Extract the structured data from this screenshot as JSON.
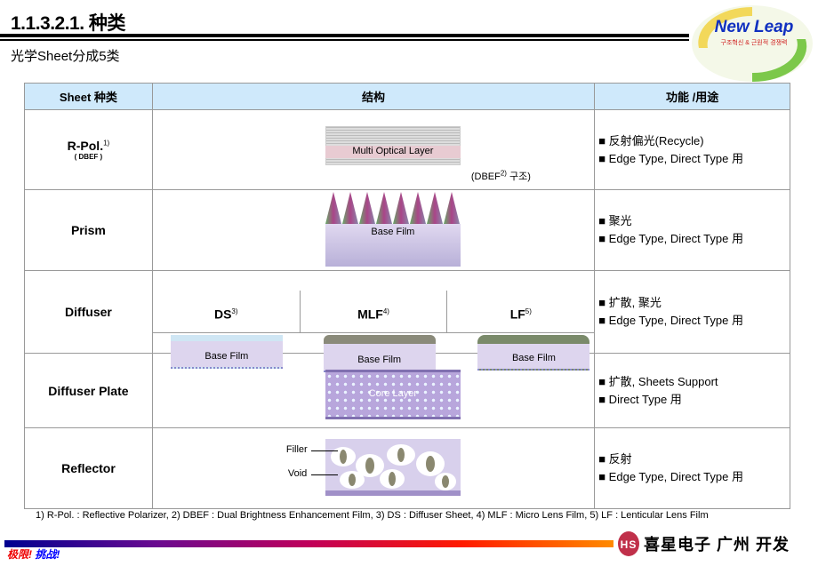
{
  "header": {
    "title": "1.1.3.2.1. 种类",
    "subtitle": "光学Sheet分成5类",
    "logo_text": "New Leap",
    "logo_subtext": "구조혁신 & 근원적 경쟁력"
  },
  "table": {
    "columns": [
      "Sheet 种类",
      "结构",
      "功能 /用途"
    ],
    "rows": [
      {
        "name": "R-Pol.",
        "sup": "1)",
        "sub": "( DBEF )",
        "figure_label": "Multi Optical  Layer",
        "figure_caption": "(DBEF",
        "caption_sup": "2)",
        "caption_tail": " 구조)",
        "functions": [
          "■ 反射偏光(Recycle)",
          "■ Edge Type, Direct Type 用"
        ]
      },
      {
        "name": "Prism",
        "figure_label": "Base Film",
        "functions": [
          "■ 聚光",
          "■ Edge Type, Direct Type 用"
        ]
      },
      {
        "name": "Diffuser",
        "subtypes": [
          {
            "label": "DS",
            "sup": "3)",
            "figure_label": "Base Film"
          },
          {
            "label": "MLF",
            "sup": "4)",
            "figure_label": "Base Film"
          },
          {
            "label": "LF",
            "sup": "5)",
            "figure_label": "Base Film"
          }
        ],
        "functions": [
          "■ 扩散, 聚光",
          "■ Edge Type, Direct Type 用"
        ]
      },
      {
        "name": "Diffuser Plate",
        "figure_label": "Core Layer",
        "functions": [
          "■ 扩散, Sheets Support",
          "■ Direct Type 用"
        ]
      },
      {
        "name": "Reflector",
        "labels": [
          "Filler",
          "Void"
        ],
        "functions": [
          "■ 反射",
          "■ Edge Type, Direct Type 用"
        ]
      }
    ]
  },
  "footnote": "1) R-Pol. : Reflective Polarizer,   2) DBEF : Dual Brightness Enhancement Film,   3) DS : Diffuser Sheet,   4) MLF : Micro Lens Film,   5) LF : Lenticular Lens Film",
  "footer": {
    "slogan_red": "极限!",
    "slogan_blue": " 挑战!",
    "company": "喜星电子 广州 开发"
  }
}
